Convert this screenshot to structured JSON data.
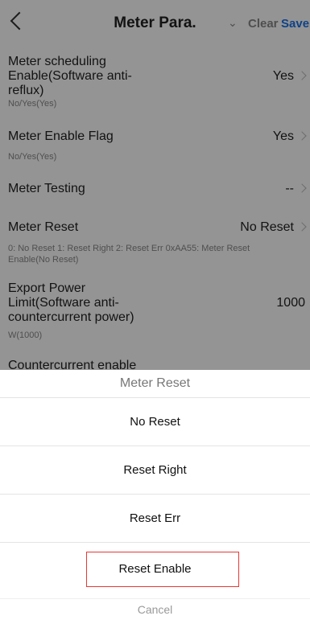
{
  "header": {
    "title": "Meter Para.",
    "clear_label": "Clear",
    "save_label": "Save"
  },
  "rows": [
    {
      "label": "Meter scheduling Enable(Software anti-reflux)",
      "value": "Yes",
      "hint": "No/Yes(Yes)"
    },
    {
      "label": "Meter Enable Flag",
      "value": "Yes",
      "hint": "No/Yes(Yes)"
    },
    {
      "label": "Meter Testing",
      "value": "--"
    },
    {
      "label": "Meter Reset",
      "value": "No Reset",
      "hint": "0: No Reset 1: Reset Right 2: Reset Err 0xAA55: Meter Reset Enable(No Reset)"
    },
    {
      "label": "Export Power Limit(Software anti-countercurrent power)",
      "value": "1000",
      "hint": "W(1000)"
    },
    {
      "label": "Countercurrent enable"
    }
  ],
  "sheet": {
    "title": "Meter Reset",
    "options": [
      "No Reset",
      "Reset Right",
      "Reset Err",
      "Reset Enable"
    ],
    "selected": "Reset Enable",
    "cancel_label": "Cancel"
  },
  "icons": {
    "back": "back-arrow-icon",
    "dropdown": "chevron-down-icon",
    "row_arrow": "chevron-right-icon"
  }
}
